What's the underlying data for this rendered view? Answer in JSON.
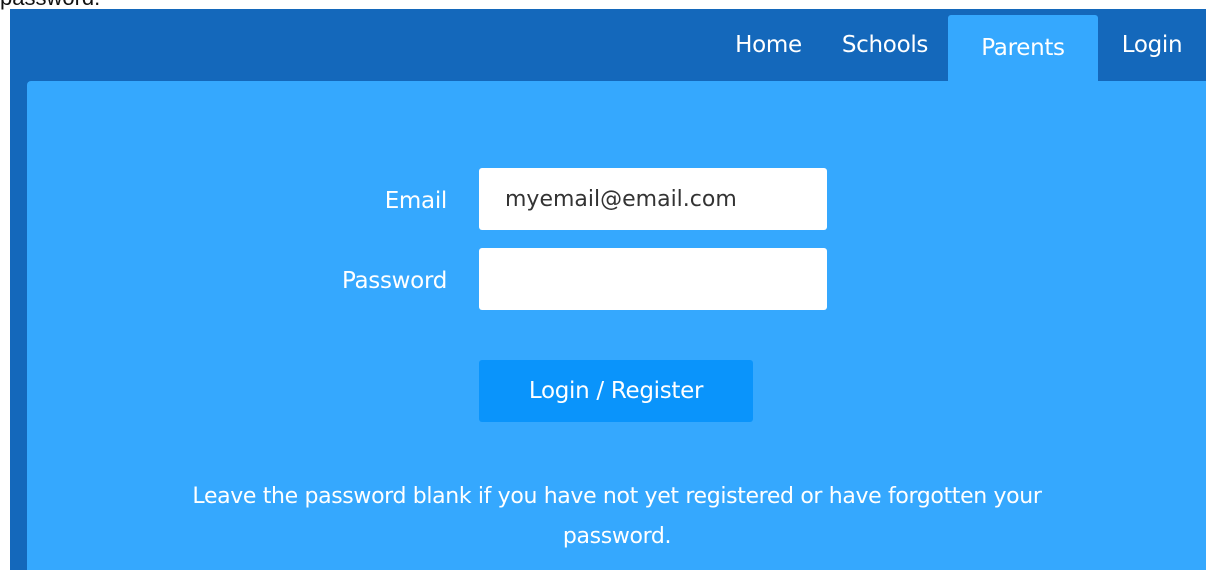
{
  "page": {
    "overflow_text": "password."
  },
  "nav": {
    "items": [
      {
        "label": "Home",
        "active": false
      },
      {
        "label": "Schools",
        "active": false
      },
      {
        "label": "Parents",
        "active": true
      },
      {
        "label": "Login",
        "active": false
      }
    ]
  },
  "form": {
    "email_label": "Email",
    "email_value": "myemail@email.com",
    "password_label": "Password",
    "password_value": "",
    "submit_label": "Login / Register",
    "hint_line1": "Leave the password blank if you have not yet registered or have forgotten your",
    "hint_line2": "password."
  },
  "colors": {
    "frame_bg": "#1468bb",
    "panel_bg": "#35a8fe",
    "button_bg": "#0a94fb",
    "text": "#ffffff"
  }
}
